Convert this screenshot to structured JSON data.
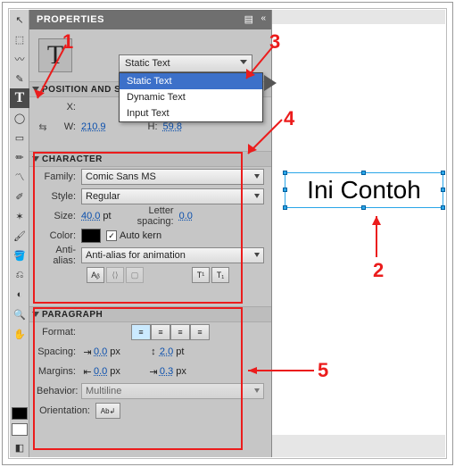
{
  "panel": {
    "title": "PROPERTIES"
  },
  "tool_icon": "T",
  "type_dropdown": {
    "selected": "Static Text",
    "options": [
      "Static Text",
      "Dynamic Text",
      "Input Text"
    ]
  },
  "sections": {
    "position": {
      "title": "POSITION AND SIZE",
      "x_label": "X:",
      "w_label": "W:",
      "h_label": "H:",
      "w": "210.9",
      "h": "59.8"
    },
    "character": {
      "title": "CHARACTER",
      "family_label": "Family:",
      "family": "Comic Sans MS",
      "style_label": "Style:",
      "style": "Regular",
      "size_label": "Size:",
      "size": "40.0",
      "size_unit": "pt",
      "spacing_label": "Letter spacing:",
      "spacing": "0.0",
      "color_label": "Color:",
      "autokern": "Auto kern",
      "aa_label": "Anti-alias:",
      "aa": "Anti-alias for animation"
    },
    "paragraph": {
      "title": "PARAGRAPH",
      "format_label": "Format:",
      "spacing_label": "Spacing:",
      "sp1": "0.0",
      "sp1_unit": "px",
      "sp2": "2.0",
      "sp2_unit": "pt",
      "margins_label": "Margins:",
      "mg1": "0.0",
      "mg1_unit": "px",
      "mg2": "0.3",
      "mg2_unit": "px",
      "behavior_label": "Behavior:",
      "behavior": "Multiline",
      "orient_label": "Orientation:"
    }
  },
  "canvas": {
    "text": "Ini Contoh"
  },
  "annotations": {
    "a1": "1",
    "a2": "2",
    "a3": "3",
    "a4": "4",
    "a5": "5"
  },
  "toolbar": {
    "icons": [
      "↖",
      "⬚",
      "〰",
      "✎",
      "T",
      "◯",
      "▭",
      "✏",
      "〽",
      "✐",
      "✶",
      "🖌",
      "🪣",
      "⎌",
      "◐",
      "🔍",
      "◧",
      "✋"
    ]
  }
}
